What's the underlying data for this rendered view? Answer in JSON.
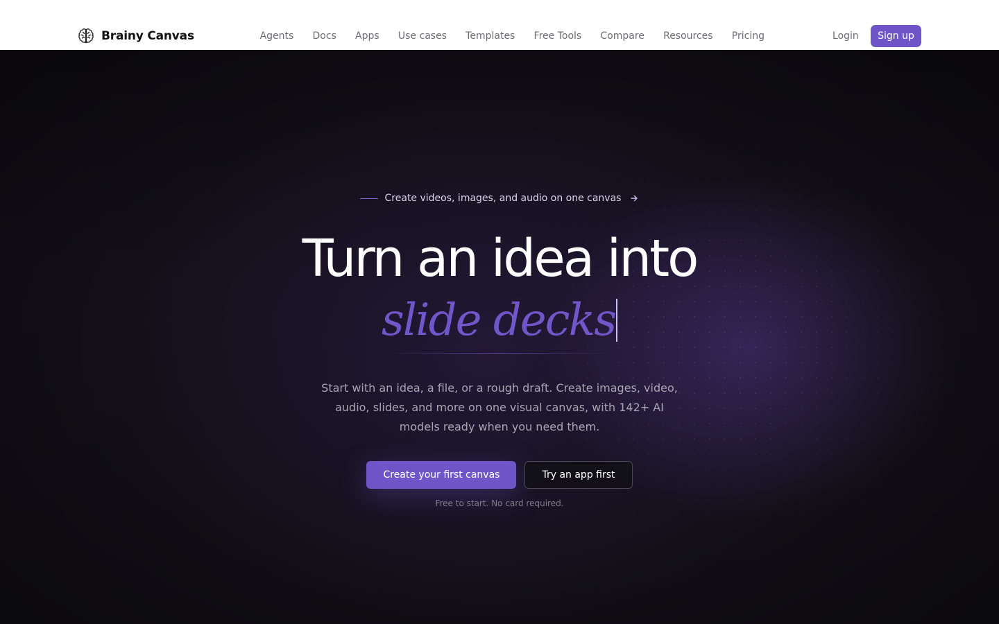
{
  "nav": {
    "brand_name": "Brainy Canvas",
    "brand_icon": "brain-icon",
    "links": [
      "Agents",
      "Docs",
      "Apps",
      "Use cases",
      "Templates",
      "Free Tools",
      "Compare",
      "Resources",
      "Pricing"
    ],
    "login_label": "Login",
    "signup_label": "Sign up"
  },
  "hero": {
    "eyebrow_text": "Create videos, images, and audio on one canvas",
    "eyebrow_icon": "arrow-right-icon",
    "headline": "Turn an idea into",
    "rotating_word": "slide decks",
    "subheadline": "Start with an idea, a file, or a rough draft. Create images, video, audio, slides, and more on one visual canvas, with 142+ AI models ready when you need them.",
    "primary_cta": "Create your first canvas",
    "secondary_cta": "Try an app first",
    "note": "Free to start. No card required."
  },
  "colors": {
    "accent": "#6f56c8",
    "accent_text": "#7057c9",
    "hero_bg": "#110f15",
    "nav_text": "#6b6b73"
  }
}
